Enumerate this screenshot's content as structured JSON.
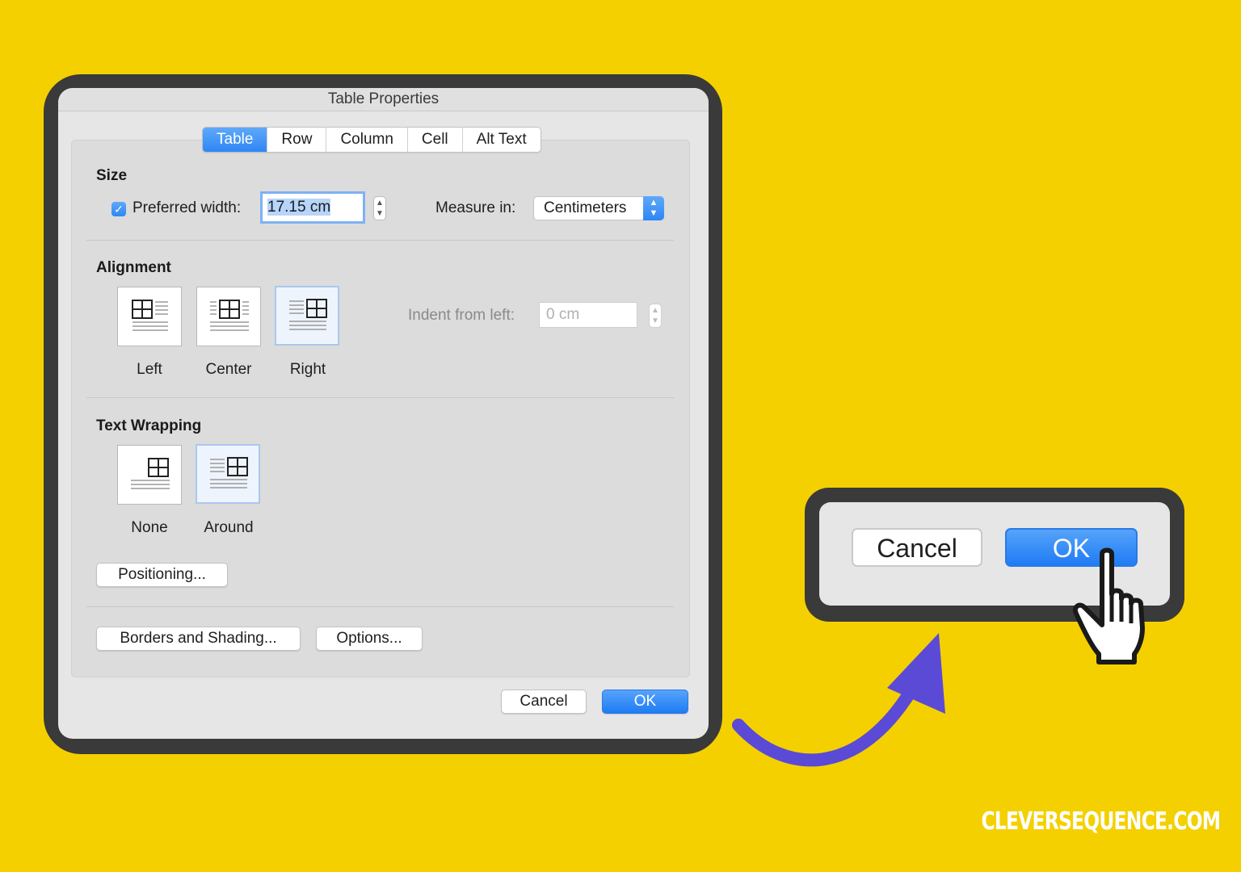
{
  "dialog": {
    "title": "Table Properties",
    "tabs": [
      {
        "label": "Table",
        "active": true
      },
      {
        "label": "Row"
      },
      {
        "label": "Column"
      },
      {
        "label": "Cell"
      },
      {
        "label": "Alt Text"
      }
    ],
    "size": {
      "heading": "Size",
      "preferred_width_checked": true,
      "preferred_width_label": "Preferred width:",
      "preferred_width_value": "17.15 cm",
      "measure_in_label": "Measure in:",
      "measure_in_value": "Centimeters"
    },
    "alignment": {
      "heading": "Alignment",
      "options": [
        "Left",
        "Center",
        "Right"
      ],
      "selected": "Right",
      "indent_label": "Indent from left:",
      "indent_value": "0 cm"
    },
    "text_wrapping": {
      "heading": "Text Wrapping",
      "options": [
        "None",
        "Around"
      ],
      "selected": "Around"
    },
    "positioning_button": "Positioning...",
    "borders_button": "Borders and Shading...",
    "options_button": "Options...",
    "cancel_button": "Cancel",
    "ok_button": "OK"
  },
  "zoom": {
    "cancel_button": "Cancel",
    "ok_button": "OK"
  },
  "icons": {
    "hand": "pointing-hand-cursor-icon",
    "arrow": "curved-arrow-icon"
  },
  "colors": {
    "background": "#f4d000",
    "accent_blue": "#2f86f5",
    "arrow_purple": "#5b4ad6"
  },
  "watermark": "CLEVERSEQUENCE.COM"
}
